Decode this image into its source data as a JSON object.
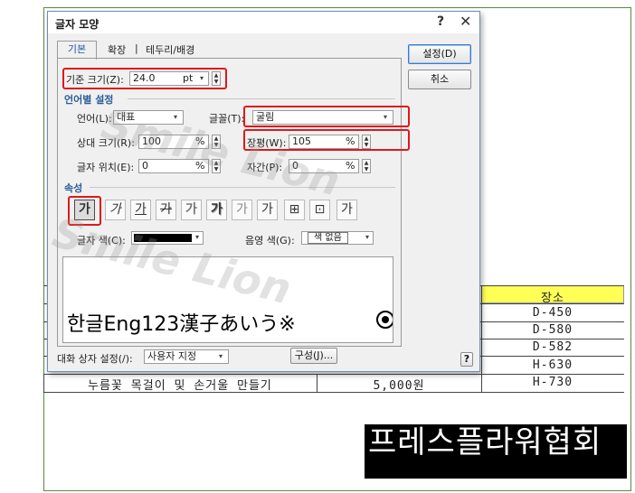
{
  "document": {
    "header_cell": "장소",
    "rows": [
      {
        "place": "D-450"
      },
      {
        "place": "D-580"
      },
      {
        "place": "D-582"
      },
      {
        "place": "H-630"
      },
      {
        "name": "누름꽃 목걸이 및 손거울 만들기",
        "price": "5,000원",
        "place": "H-730"
      }
    ],
    "banner_text": "프레스플라워협회",
    "header_color": "#ffff55"
  },
  "dialog": {
    "title": "글자 모양",
    "help_icon": "?",
    "close_icon": "✕",
    "tabs": [
      {
        "label": "기본"
      },
      {
        "label": "확장"
      },
      {
        "label": "테두리/배경"
      }
    ],
    "tab_separator": "|",
    "buttons": {
      "ok": "설정(D)",
      "cancel": "취소",
      "compose": "구성(J)...",
      "help": "?"
    },
    "base_size": {
      "label": "기준 크기(Z):",
      "value": "24.0",
      "unit": "pt"
    },
    "section_lang": "언어별 설정",
    "language": {
      "label": "언어(L):",
      "value": "대표"
    },
    "font": {
      "label": "글꼴(T):",
      "value": "굴림"
    },
    "relative_size": {
      "label": "상대 크기(R):",
      "value": "100",
      "unit": "%"
    },
    "width_ratio": {
      "label": "장평(W):",
      "value": "105",
      "unit": "%"
    },
    "char_position": {
      "label": "글자 위치(E):",
      "value": "0",
      "unit": "%"
    },
    "spacing": {
      "label": "자간(P):",
      "value": "0",
      "unit": "%"
    },
    "section_attr": "속성",
    "attr_buttons": [
      "가",
      "가",
      "가",
      "가",
      "가",
      "가",
      "가",
      "가",
      "⊞",
      "⊡",
      "가"
    ],
    "text_color": {
      "label": "글자 색(C):"
    },
    "shade_color": {
      "label": "음영 색(G):",
      "value": "색 없음"
    },
    "preview_text": "한글Eng123漢子あいう※",
    "dialog_setting": {
      "label": "대화 상자 설정(/):",
      "value": "사용자 지정"
    },
    "accent_color": "#e01818"
  },
  "watermark": {
    "line1": "Smile Lion",
    "line2": "Smile Lion"
  }
}
